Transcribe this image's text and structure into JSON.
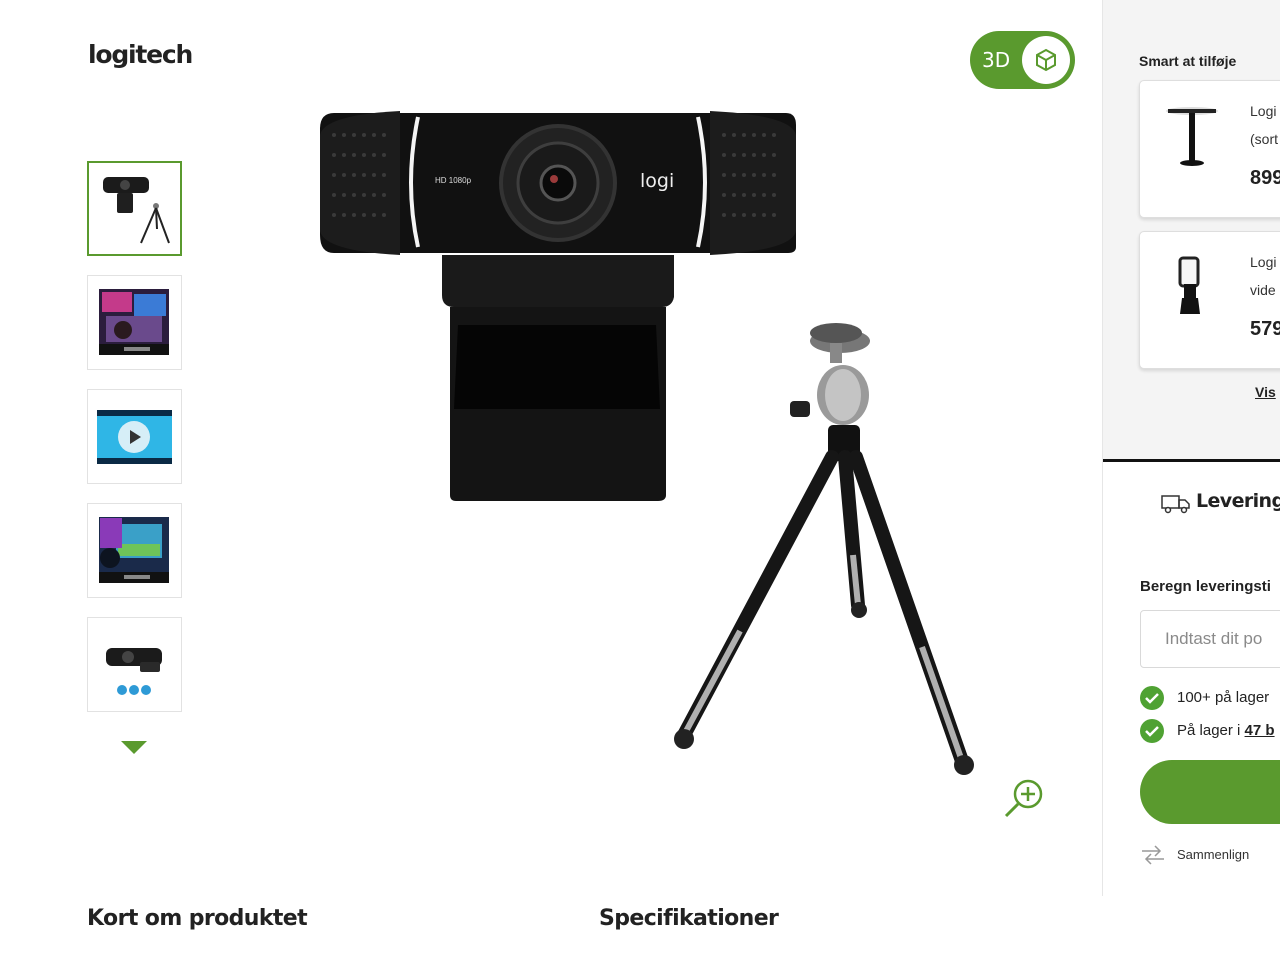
{
  "brand": {
    "logo_text": "logitech"
  },
  "gallery": {
    "thumbnails": [
      {
        "name": "thumb-webcam-tripod",
        "active": true
      },
      {
        "name": "thumb-gaming-setup",
        "active": false
      },
      {
        "name": "thumb-video",
        "active": false
      },
      {
        "name": "thumb-gaming-screen",
        "active": false
      },
      {
        "name": "thumb-webcam-more",
        "active": false
      }
    ],
    "more_icon": "chevron-down-icon",
    "main_image": {
      "camera_label": "HD 1080p",
      "camera_logo": "logi"
    },
    "view_3d_label": "3D",
    "zoom_icon": "zoom-in-icon"
  },
  "sections": {
    "overview_title": "Kort om produktet",
    "specs_title": "Specifikationer"
  },
  "accessories": {
    "title": "Smart at tilføje",
    "items": [
      {
        "line1": "Logi",
        "line2": "(sort",
        "price": "899"
      },
      {
        "line1": "Logi",
        "line2": "vide",
        "price": "579"
      }
    ],
    "show_all_link": "Vis"
  },
  "delivery": {
    "title": "Levering",
    "subtitle": "Beregn leveringsti",
    "postal_placeholder": "Indtast dit po",
    "stock": [
      {
        "text": "100+ på lager",
        "link": ""
      },
      {
        "text": "På lager i ",
        "link": "47 b"
      }
    ],
    "compare_label": "Sammenlign"
  },
  "colors": {
    "accent_green": "#5a9a2e",
    "check_green": "#4fa233",
    "panel_bg": "#f4f4f4"
  }
}
